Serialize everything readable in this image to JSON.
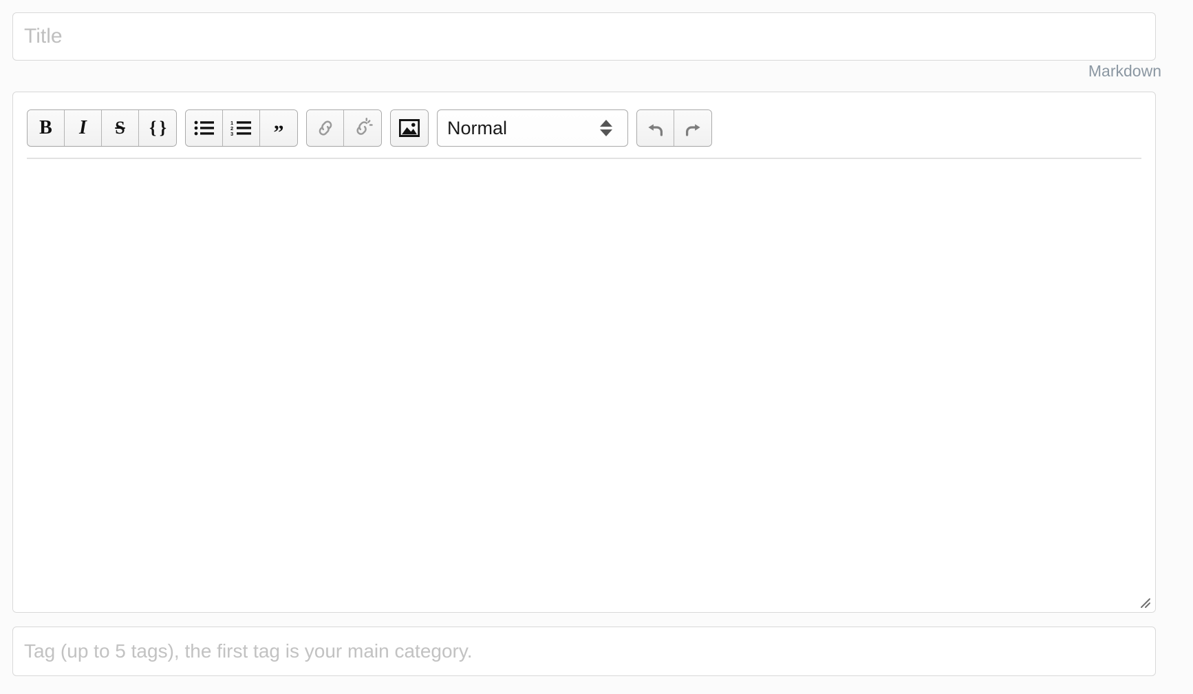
{
  "title_input": {
    "placeholder": "Title",
    "value": ""
  },
  "mode_label": "Markdown",
  "toolbar": {
    "groups": [
      {
        "name": "text-style",
        "buttons": [
          {
            "name": "bold-button",
            "glyph": "B",
            "label": "Bold",
            "enabled": true
          },
          {
            "name": "italic-button",
            "glyph": "I",
            "label": "Italic",
            "enabled": true
          },
          {
            "name": "strikethrough-button",
            "glyph": "S",
            "label": "Strikethrough",
            "enabled": true
          },
          {
            "name": "code-button",
            "glyph": "{ }",
            "label": "Code",
            "enabled": true
          }
        ]
      },
      {
        "name": "lists",
        "buttons": [
          {
            "name": "bullet-list-button",
            "icon": "bullet-list-icon",
            "label": "Bulleted list",
            "enabled": true
          },
          {
            "name": "numbered-list-button",
            "icon": "numbered-list-icon",
            "label": "Numbered list",
            "enabled": true
          },
          {
            "name": "blockquote-button",
            "glyph": "”",
            "label": "Blockquote",
            "enabled": true
          }
        ]
      },
      {
        "name": "links",
        "buttons": [
          {
            "name": "link-button",
            "icon": "link-icon",
            "label": "Insert link",
            "enabled": false
          },
          {
            "name": "unlink-button",
            "icon": "unlink-icon",
            "label": "Remove link",
            "enabled": false
          }
        ]
      },
      {
        "name": "media",
        "buttons": [
          {
            "name": "image-button",
            "icon": "image-icon",
            "label": "Insert image",
            "enabled": true
          }
        ]
      },
      {
        "name": "history",
        "buttons": [
          {
            "name": "undo-button",
            "icon": "undo-icon",
            "label": "Undo",
            "enabled": true
          },
          {
            "name": "redo-button",
            "icon": "redo-icon",
            "label": "Redo",
            "enabled": true
          }
        ]
      }
    ],
    "format_select": {
      "selected": "Normal",
      "options": [
        "Normal"
      ],
      "stepper_icon": "updown-stepper-icon"
    }
  },
  "editor_body": {
    "content": "",
    "resize_handle_icon": "resize-grip-icon"
  },
  "tag_input": {
    "placeholder": "Tag (up to 5 tags), the first tag is your main category.",
    "value": ""
  },
  "colors": {
    "page_background": "#fbfbfb",
    "field_background": "#ffffff",
    "field_border": "#d8d8d8",
    "button_border": "#a9a9a9",
    "placeholder_text": "#bfbfbf",
    "mode_label_text": "#8b97a2",
    "icon_enabled": "#111111",
    "icon_disabled": "#9a9a9a",
    "rule": "#e2e2e2"
  }
}
